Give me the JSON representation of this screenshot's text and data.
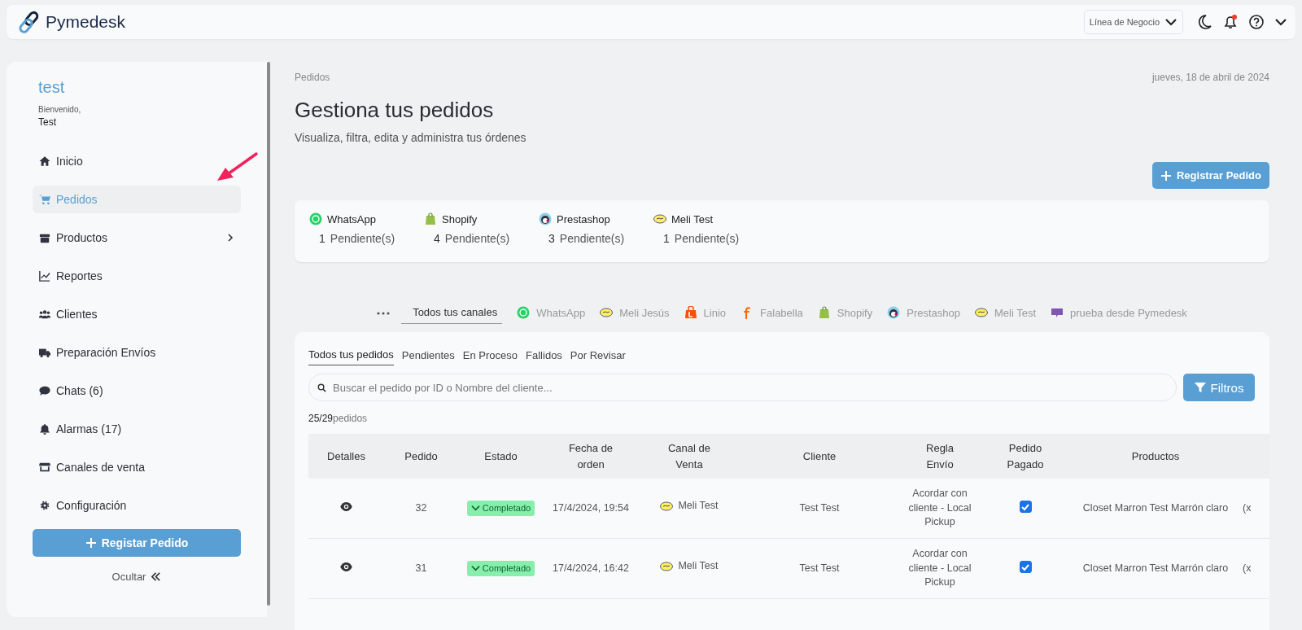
{
  "header": {
    "brand": "Pymedesk",
    "business_line": {
      "label": "Línea de Negocio"
    },
    "notifications": {
      "unread": true
    }
  },
  "sidebar": {
    "user_name": "test",
    "greeting": "Bienvenido,",
    "display_name": "Test",
    "items": [
      {
        "label": "Inicio",
        "kind": "home",
        "selected": false,
        "submenu": false
      },
      {
        "label": "Pedidos",
        "kind": "cart",
        "selected": true,
        "submenu": false
      },
      {
        "label": "Productos",
        "kind": "box",
        "selected": false,
        "submenu": true
      },
      {
        "label": "Reportes",
        "kind": "chart",
        "selected": false,
        "submenu": false
      },
      {
        "label": "Clientes",
        "kind": "users",
        "selected": false,
        "submenu": false
      },
      {
        "label": "Preparación Envíos",
        "kind": "truck",
        "selected": false,
        "submenu": false
      },
      {
        "label": "Chats (6)",
        "kind": "chat",
        "selected": false,
        "submenu": false
      },
      {
        "label": "Alarmas (17)",
        "kind": "bell",
        "selected": false,
        "submenu": false
      },
      {
        "label": "Canales de venta",
        "kind": "store",
        "selected": false,
        "submenu": false
      },
      {
        "label": "Configuración",
        "kind": "gear",
        "selected": false,
        "submenu": false
      }
    ],
    "register_button": "Registar Pedido",
    "hide_link": "Ocultar"
  },
  "main": {
    "breadcrumb": "Pedidos",
    "date": "jueves, 18 de abril de 2024",
    "title": "Gestiona tus pedidos",
    "subtitle": "Visualiza, filtra, edita y administra tus órdenes",
    "register_button": "Registrar Pedido",
    "pending_summary": [
      {
        "channel": "WhatsApp",
        "kind": "whatsapp",
        "count": "1",
        "label": "Pendiente(s)"
      },
      {
        "channel": "Shopify",
        "kind": "shopify",
        "count": "4",
        "label": "Pendiente(s)"
      },
      {
        "channel": "Prestashop",
        "kind": "prestashop",
        "count": "3",
        "label": "Pendiente(s)"
      },
      {
        "channel": "Meli Test",
        "kind": "meli",
        "count": "1",
        "label": "Pendiente(s)"
      }
    ],
    "channel_tabs": [
      {
        "label": "Todos tus canales",
        "kind": "all",
        "selected": true
      },
      {
        "label": "WhatsApp",
        "kind": "whatsapp",
        "selected": false
      },
      {
        "label": "Meli Jesús",
        "kind": "meli",
        "selected": false
      },
      {
        "label": "Linio",
        "kind": "linio",
        "selected": false
      },
      {
        "label": "Falabella",
        "kind": "falabella",
        "selected": false
      },
      {
        "label": "Shopify",
        "kind": "shopify",
        "selected": false
      },
      {
        "label": "Prestashop",
        "kind": "prestashop",
        "selected": false
      },
      {
        "label": "Meli Test",
        "kind": "meli",
        "selected": false
      },
      {
        "label": "prueba desde Pymedesk",
        "kind": "woo",
        "selected": false
      }
    ],
    "order_tabs": [
      {
        "label": "Todos tus pedidos",
        "selected": true
      },
      {
        "label": "Pendientes",
        "selected": false
      },
      {
        "label": "En Proceso",
        "selected": false
      },
      {
        "label": "Fallidos",
        "selected": false
      },
      {
        "label": "Por Revisar",
        "selected": false
      }
    ],
    "search": {
      "placeholder": "Buscar el pedido por ID o Nombre del cliente..."
    },
    "filters_button": "Filtros",
    "count": {
      "shown": "25/29",
      "unit": "pedidos"
    },
    "table": {
      "columns": [
        "Detalles",
        "Pedido",
        "Estado",
        "Fecha de orden",
        "Canal de Venta",
        "Cliente",
        "Regla Envío",
        "Pedido Pagado",
        "Productos"
      ],
      "rows": [
        {
          "order": "32",
          "status": "Completado",
          "date": "17/4/2024, 19:54",
          "channel": "Meli Test",
          "kind": "meli",
          "client": "Test Test",
          "shipping_rule": "Acordar con cliente - Local Pickup",
          "paid": true,
          "products": "Closet Marron Test Marrón claro",
          "column_10": "(x"
        },
        {
          "order": "31",
          "status": "Completado",
          "date": "17/4/2024, 16:42",
          "channel": "Meli Test",
          "kind": "meli",
          "client": "Test Test",
          "shipping_rule": "Acordar con cliente - Local Pickup",
          "paid": true,
          "products": "Closet Marron Test Marrón claro",
          "column_10": "(x"
        }
      ]
    }
  }
}
